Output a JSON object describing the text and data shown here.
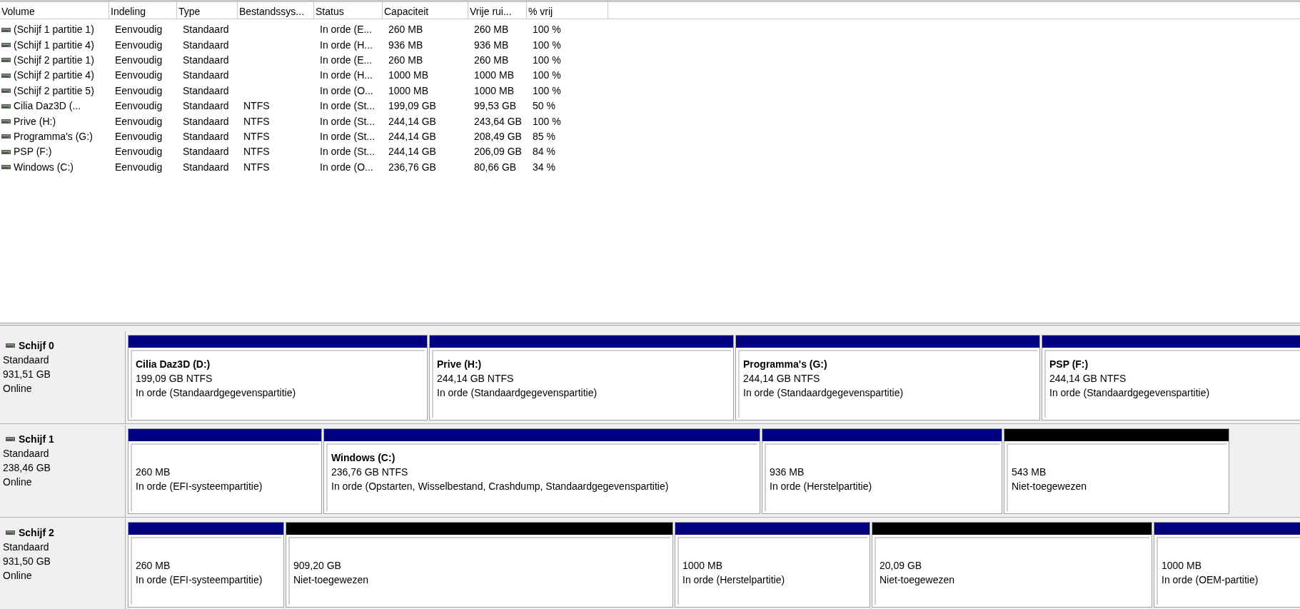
{
  "table": {
    "columns": [
      "Volume",
      "Indeling",
      "Type",
      "Bestandssys...",
      "Status",
      "Capaciteit",
      "Vrije rui...",
      "% vrij"
    ],
    "rows": [
      [
        "(Schijf 1 partitie 1)",
        "Eenvoudig",
        "Standaard",
        "",
        "In orde (E...",
        "260 MB",
        "260 MB",
        "100 %"
      ],
      [
        "(Schijf 1 partitie 4)",
        "Eenvoudig",
        "Standaard",
        "",
        "In orde (H...",
        "936 MB",
        "936 MB",
        "100 %"
      ],
      [
        "(Schijf 2 partitie 1)",
        "Eenvoudig",
        "Standaard",
        "",
        "In orde (E...",
        "260 MB",
        "260 MB",
        "100 %"
      ],
      [
        "(Schijf 2 partitie 4)",
        "Eenvoudig",
        "Standaard",
        "",
        "In orde (H...",
        "1000 MB",
        "1000 MB",
        "100 %"
      ],
      [
        "(Schijf 2 partitie 5)",
        "Eenvoudig",
        "Standaard",
        "",
        "In orde (O...",
        "1000 MB",
        "1000 MB",
        "100 %"
      ],
      [
        "Cilia Daz3D (...",
        "Eenvoudig",
        "Standaard",
        "NTFS",
        "In orde (St...",
        "199,09 GB",
        "99,53 GB",
        "50 %"
      ],
      [
        "Prive (H:)",
        "Eenvoudig",
        "Standaard",
        "NTFS",
        "In orde (St...",
        "244,14 GB",
        "243,64 GB",
        "100 %"
      ],
      [
        "Programma's (G:)",
        "Eenvoudig",
        "Standaard",
        "NTFS",
        "In orde (St...",
        "244,14 GB",
        "208,49 GB",
        "85 %"
      ],
      [
        "PSP (F:)",
        "Eenvoudig",
        "Standaard",
        "NTFS",
        "In orde (St...",
        "244,14 GB",
        "206,09 GB",
        "84 %"
      ],
      [
        "Windows (C:)",
        "Eenvoudig",
        "Standaard",
        "NTFS",
        "In orde (O...",
        "236,76 GB",
        "80,66 GB",
        "34 %"
      ]
    ]
  },
  "disks": [
    {
      "name": "Schijf 0",
      "type": "Standaard",
      "size": "931,51 GB",
      "state": "Online",
      "partitions": [
        {
          "kind": "primary",
          "title": "Cilia Daz3D  (D:)",
          "size": "199,09 GB NTFS",
          "status": "In orde (Standaardgegevenspartitie)"
        },
        {
          "kind": "primary",
          "title": "Prive  (H:)",
          "size": "244,14 GB NTFS",
          "status": "In orde (Standaardgegevenspartitie)"
        },
        {
          "kind": "primary",
          "title": "Programma's  (G:)",
          "size": "244,14 GB NTFS",
          "status": "In orde (Standaardgegevenspartitie)"
        },
        {
          "kind": "primary",
          "title": "PSP  (F:)",
          "size": "244,14 GB NTFS",
          "status": "In orde (Standaardgegevenspartitie)"
        }
      ]
    },
    {
      "name": "Schijf 1",
      "type": "Standaard",
      "size": "238,46 GB",
      "state": "Online",
      "partitions": [
        {
          "kind": "primary",
          "size": "260 MB",
          "status": "In orde (EFI-systeempartitie)"
        },
        {
          "kind": "primary",
          "title": "Windows  (C:)",
          "size": "236,76 GB NTFS",
          "status": "In orde (Opstarten, Wisselbestand, Crashdump, Standaardgegevenspartitie)"
        },
        {
          "kind": "primary",
          "size": "936 MB",
          "status": "In orde (Herstelpartitie)"
        },
        {
          "kind": "unallocated",
          "size": "543 MB",
          "status": "Niet-toegewezen"
        }
      ]
    },
    {
      "name": "Schijf 2",
      "type": "Standaard",
      "size": "931,50 GB",
      "state": "Online",
      "partitions": [
        {
          "kind": "primary",
          "size": "260 MB",
          "status": "In orde (EFI-systeempartitie)"
        },
        {
          "kind": "unallocated",
          "size": "909,20 GB",
          "status": "Niet-toegewezen"
        },
        {
          "kind": "primary",
          "size": "1000 MB",
          "status": "In orde (Herstelpartitie)"
        },
        {
          "kind": "unallocated",
          "size": "20,09 GB",
          "status": "Niet-toegewezen"
        },
        {
          "kind": "primary",
          "size": "1000 MB",
          "status": "In orde (OEM-partitie)"
        }
      ]
    }
  ]
}
